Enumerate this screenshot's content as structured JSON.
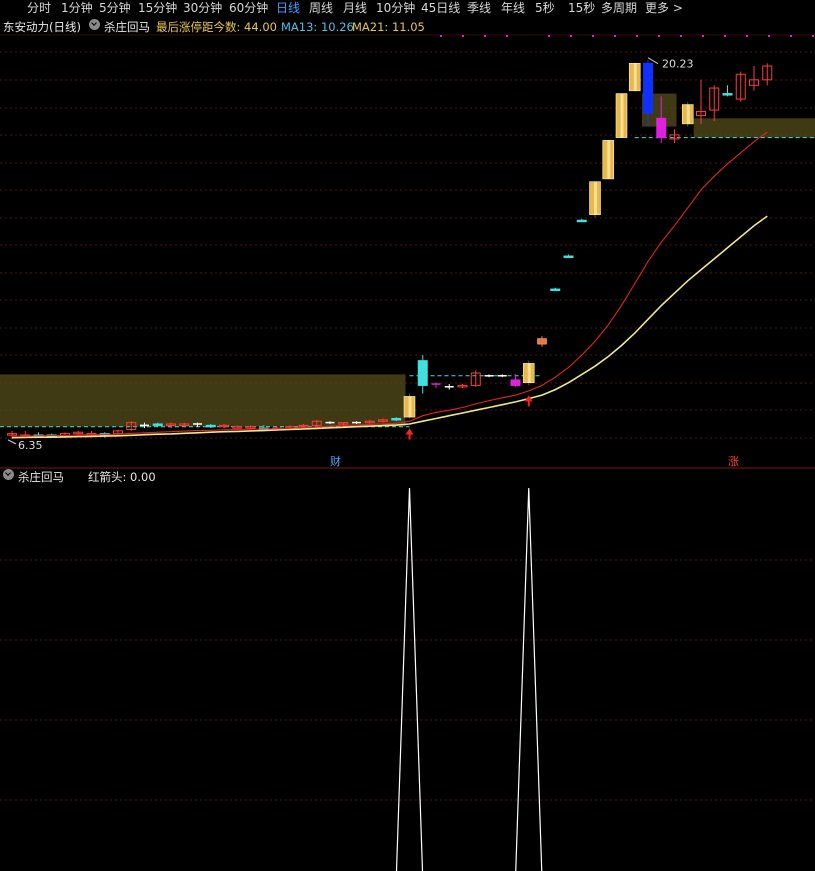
{
  "periods": [
    "分时",
    "1分钟",
    "5分钟",
    "15分钟",
    "30分钟",
    "60分钟",
    "日线",
    "周线",
    "月线",
    "10分钟",
    "45日线",
    "季线",
    "年线",
    "5秒",
    "15秒",
    "多周期",
    "更多 >"
  ],
  "active_period": "日线",
  "header": {
    "stock": "东安动力(日线)",
    "indicator_name": "杀庄回马",
    "limit_label": "最后涨停距今数: 44.00",
    "ma13": "MA13: 10.26",
    "ma21": "MA21: 11.05"
  },
  "price_marks": {
    "high": "20.23",
    "low": "6.35"
  },
  "event_labels": {
    "finance": "财",
    "limit_up": "涨"
  },
  "sub_panel": {
    "name": "杀庄回马",
    "value_label": "红箭头: 0.00"
  },
  "colors": {
    "up": "#ff3b3b",
    "down": "#3fe0e0",
    "ma13": "#e0252a",
    "ma21": "#f0e68c",
    "gold": "#e8b84a",
    "blue_candle": "#1030ff",
    "magenta": "#e020e0",
    "zone": "#4a4418"
  },
  "chart_data": {
    "type": "candlestick",
    "candles": [
      {
        "o": 6.65,
        "h": 6.75,
        "l": 6.45,
        "c": 6.6,
        "k": "up"
      },
      {
        "o": 6.6,
        "h": 6.75,
        "l": 6.5,
        "c": 6.55,
        "k": "up"
      },
      {
        "o": 6.55,
        "h": 6.7,
        "l": 6.5,
        "c": 6.6,
        "k": "down"
      },
      {
        "o": 6.6,
        "h": 6.65,
        "l": 6.5,
        "c": 6.55,
        "k": "down"
      },
      {
        "o": 6.55,
        "h": 6.7,
        "l": 6.5,
        "c": 6.65,
        "k": "up"
      },
      {
        "o": 6.7,
        "h": 6.75,
        "l": 6.6,
        "c": 6.65,
        "k": "up"
      },
      {
        "o": 6.65,
        "h": 6.75,
        "l": 6.55,
        "c": 6.6,
        "k": "up"
      },
      {
        "o": 6.6,
        "h": 6.7,
        "l": 6.5,
        "c": 6.65,
        "k": "down"
      },
      {
        "o": 6.65,
        "h": 6.8,
        "l": 6.6,
        "c": 6.75,
        "k": "up"
      },
      {
        "o": 6.8,
        "h": 7.1,
        "l": 6.75,
        "c": 7.05,
        "k": "up"
      },
      {
        "o": 6.95,
        "h": 7.05,
        "l": 6.85,
        "c": 6.95,
        "k": "doji"
      },
      {
        "o": 7.0,
        "h": 7.05,
        "l": 6.9,
        "c": 6.95,
        "k": "down"
      },
      {
        "o": 6.95,
        "h": 7.05,
        "l": 6.85,
        "c": 7.0,
        "k": "up"
      },
      {
        "o": 7.0,
        "h": 7.05,
        "l": 6.9,
        "c": 6.95,
        "k": "up"
      },
      {
        "o": 6.95,
        "h": 7.05,
        "l": 6.9,
        "c": 7.0,
        "k": "doji"
      },
      {
        "o": 6.9,
        "h": 7.0,
        "l": 6.85,
        "c": 6.95,
        "k": "down"
      },
      {
        "o": 6.95,
        "h": 7.0,
        "l": 6.85,
        "c": 6.9,
        "k": "up"
      },
      {
        "o": 6.9,
        "h": 6.95,
        "l": 6.85,
        "c": 6.9,
        "k": "up"
      },
      {
        "o": 6.9,
        "h": 6.95,
        "l": 6.8,
        "c": 6.85,
        "k": "up"
      },
      {
        "o": 6.85,
        "h": 6.95,
        "l": 6.75,
        "c": 6.8,
        "k": "down"
      },
      {
        "o": 6.8,
        "h": 6.9,
        "l": 6.75,
        "c": 6.85,
        "k": "up"
      },
      {
        "o": 6.85,
        "h": 6.95,
        "l": 6.8,
        "c": 6.9,
        "k": "up"
      },
      {
        "o": 6.9,
        "h": 7.0,
        "l": 6.85,
        "c": 6.95,
        "k": "up"
      },
      {
        "o": 6.95,
        "h": 7.15,
        "l": 6.9,
        "c": 7.1,
        "k": "up"
      },
      {
        "o": 7.05,
        "h": 7.1,
        "l": 7.0,
        "c": 7.05,
        "k": "doji"
      },
      {
        "o": 7.0,
        "h": 7.05,
        "l": 6.95,
        "c": 7.05,
        "k": "up"
      },
      {
        "o": 7.05,
        "h": 7.1,
        "l": 7.0,
        "c": 7.05,
        "k": "doji"
      },
      {
        "o": 7.05,
        "h": 7.15,
        "l": 7.0,
        "c": 7.1,
        "k": "up"
      },
      {
        "o": 7.1,
        "h": 7.2,
        "l": 7.05,
        "c": 7.15,
        "k": "up"
      },
      {
        "o": 7.15,
        "h": 7.25,
        "l": 7.1,
        "c": 7.2,
        "k": "down"
      },
      {
        "o": 7.25,
        "h": 8.1,
        "l": 7.2,
        "c": 8.0,
        "k": "gold"
      },
      {
        "o": 8.4,
        "h": 9.5,
        "l": 8.1,
        "c": 9.3,
        "k": "down"
      },
      {
        "o": 8.45,
        "h": 8.5,
        "l": 8.3,
        "c": 8.45,
        "k": "magentadoji"
      },
      {
        "o": 8.35,
        "h": 8.45,
        "l": 8.25,
        "c": 8.35,
        "k": "doji"
      },
      {
        "o": 8.35,
        "h": 8.45,
        "l": 8.3,
        "c": 8.4,
        "k": "up"
      },
      {
        "o": 8.4,
        "h": 8.95,
        "l": 8.35,
        "c": 8.85,
        "k": "up"
      },
      {
        "o": 8.75,
        "h": 8.8,
        "l": 8.7,
        "c": 8.75,
        "k": "doji"
      },
      {
        "o": 8.75,
        "h": 8.8,
        "l": 8.7,
        "c": 8.75,
        "k": "doji"
      },
      {
        "o": 8.6,
        "h": 8.8,
        "l": 8.35,
        "c": 8.4,
        "k": "magenta"
      },
      {
        "o": 8.5,
        "h": 9.3,
        "l": 8.4,
        "c": 9.2,
        "k": "gold"
      },
      {
        "o": 9.9,
        "h": 10.2,
        "l": 9.8,
        "c": 10.1,
        "k": "upgold"
      },
      {
        "o": 11.9,
        "h": 11.95,
        "l": 11.85,
        "c": 11.9,
        "k": "flat"
      },
      {
        "o": 13.1,
        "h": 13.15,
        "l": 13.05,
        "c": 13.1,
        "k": "flat"
      },
      {
        "o": 14.4,
        "h": 14.45,
        "l": 14.35,
        "c": 14.4,
        "k": "flat"
      },
      {
        "o": 14.6,
        "h": 15.8,
        "l": 14.5,
        "c": 15.8,
        "k": "gold"
      },
      {
        "o": 15.9,
        "h": 17.3,
        "l": 15.9,
        "c": 17.3,
        "k": "gold"
      },
      {
        "o": 17.4,
        "h": 19.0,
        "l": 17.4,
        "c": 19.0,
        "k": "gold"
      },
      {
        "o": 19.1,
        "h": 20.1,
        "l": 19.1,
        "c": 20.1,
        "k": "gold"
      },
      {
        "o": 20.1,
        "h": 20.23,
        "l": 17.8,
        "c": 18.3,
        "k": "blue"
      },
      {
        "o": 18.1,
        "h": 18.9,
        "l": 17.2,
        "c": 17.4,
        "k": "magenta"
      },
      {
        "o": 17.5,
        "h": 17.7,
        "l": 17.2,
        "c": 17.35,
        "k": "up"
      },
      {
        "o": 17.9,
        "h": 18.7,
        "l": 17.8,
        "c": 18.6,
        "k": "gold"
      },
      {
        "o": 18.2,
        "h": 19.5,
        "l": 17.9,
        "c": 18.35,
        "k": "up"
      },
      {
        "o": 18.4,
        "h": 19.3,
        "l": 18.0,
        "c": 19.2,
        "k": "up"
      },
      {
        "o": 19.0,
        "h": 19.3,
        "l": 18.9,
        "c": 19.0,
        "k": "down"
      },
      {
        "o": 18.8,
        "h": 19.8,
        "l": 18.7,
        "c": 19.7,
        "k": "up"
      },
      {
        "o": 19.3,
        "h": 20.0,
        "l": 19.1,
        "c": 19.5,
        "k": "up"
      },
      {
        "o": 19.5,
        "h": 20.1,
        "l": 19.3,
        "c": 20.0,
        "k": "up"
      }
    ],
    "ma13": [
      6.55,
      6.56,
      6.57,
      6.58,
      6.58,
      6.6,
      6.61,
      6.62,
      6.63,
      6.66,
      6.68,
      6.7,
      6.72,
      6.74,
      6.76,
      6.77,
      6.79,
      6.8,
      6.81,
      6.82,
      6.83,
      6.85,
      6.87,
      6.89,
      6.92,
      6.94,
      6.96,
      6.98,
      7.0,
      7.02,
      7.1,
      7.3,
      7.42,
      7.5,
      7.6,
      7.73,
      7.85,
      7.95,
      8.05,
      8.2,
      8.4,
      8.7,
      9.05,
      9.5,
      10.0,
      10.6,
      11.3,
      12.1,
      12.9,
      13.6,
      14.2,
      14.85,
      15.5,
      16.0,
      16.45,
      16.85,
      17.25,
      17.6
    ],
    "ma21": [
      6.5,
      6.51,
      6.52,
      6.52,
      6.53,
      6.54,
      6.55,
      6.56,
      6.57,
      6.59,
      6.61,
      6.63,
      6.64,
      6.66,
      6.68,
      6.7,
      6.72,
      6.73,
      6.75,
      6.76,
      6.78,
      6.8,
      6.82,
      6.84,
      6.86,
      6.88,
      6.9,
      6.92,
      6.94,
      6.96,
      7.0,
      7.1,
      7.2,
      7.3,
      7.4,
      7.5,
      7.6,
      7.7,
      7.8,
      7.92,
      8.05,
      8.25,
      8.5,
      8.8,
      9.1,
      9.45,
      9.85,
      10.3,
      10.8,
      11.3,
      11.75,
      12.2,
      12.6,
      13.0,
      13.4,
      13.8,
      14.2,
      14.55
    ],
    "signal": [
      0,
      0,
      0,
      0,
      0,
      0,
      0,
      0,
      0,
      0,
      0,
      0,
      0,
      0,
      0,
      0,
      0,
      0,
      0,
      0,
      0,
      0,
      0,
      0,
      0,
      0,
      0,
      0,
      0,
      0,
      1,
      0,
      0,
      0,
      0,
      0,
      0,
      0,
      0,
      1,
      0,
      0,
      0,
      0,
      0,
      0,
      0,
      0,
      0,
      0,
      0,
      0,
      0,
      0,
      0,
      0,
      0,
      0
    ],
    "ylim": [
      6.2,
      20.8
    ]
  }
}
